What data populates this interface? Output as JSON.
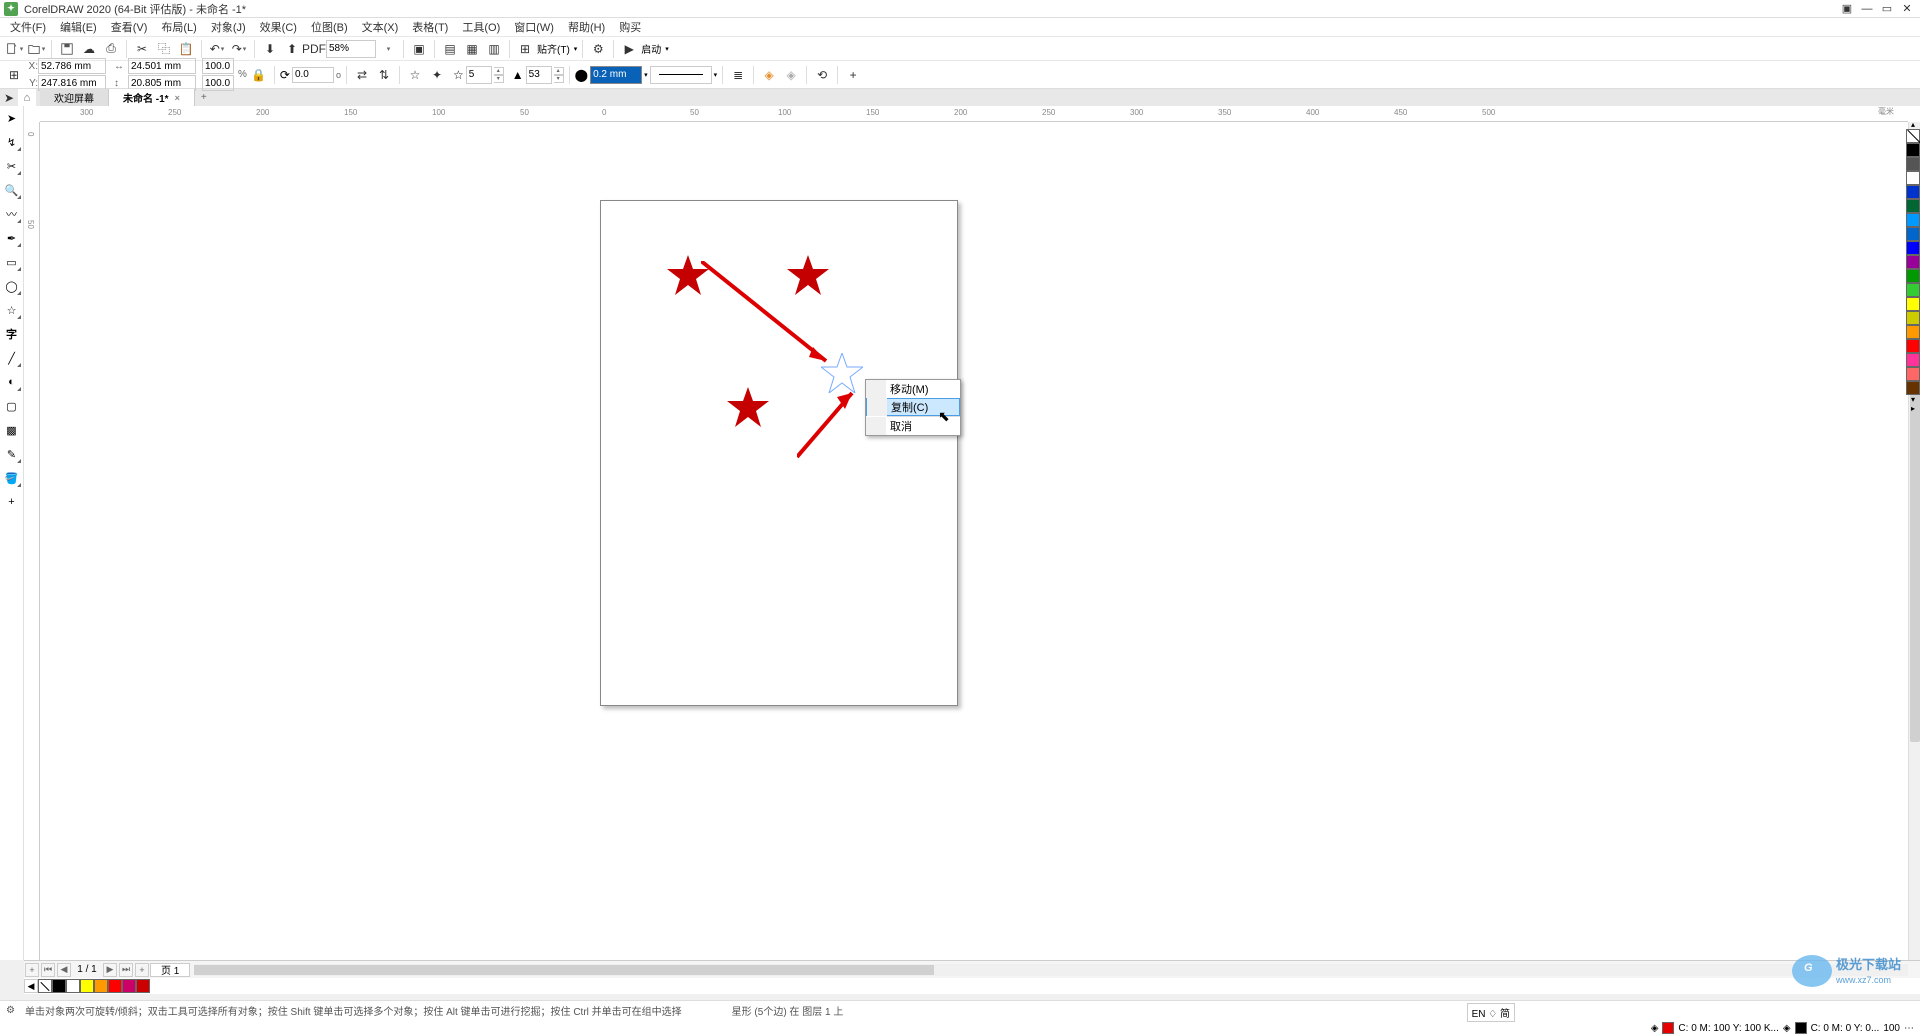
{
  "title": "CorelDRAW 2020 (64-Bit 评估版) - 未命名 -1*",
  "menus": [
    "文件(F)",
    "编辑(E)",
    "查看(V)",
    "布局(L)",
    "对象(J)",
    "效果(C)",
    "位图(B)",
    "文本(X)",
    "表格(T)",
    "工具(O)",
    "窗口(W)",
    "帮助(H)",
    "购买"
  ],
  "zoom": "58%",
  "snap_label": "贴齐(T)",
  "launch_label": "启动",
  "xy": {
    "x_label": "X:",
    "y_label": "Y:",
    "x": "52.786 mm",
    "y": "247.816 mm"
  },
  "dims": {
    "w": "24.501 mm",
    "h": "20.805 mm"
  },
  "pct": {
    "w": "100.0",
    "h": "100.0",
    "unit": "%"
  },
  "rotate": "0.0",
  "deg": "o",
  "star_points": "5",
  "star_sharp": "53",
  "outline_width": "0.2 mm",
  "tabs": {
    "welcome": "欢迎屏幕",
    "doc": "未命名 -1*"
  },
  "ruler_h": [
    "300",
    "250",
    "200",
    "150",
    "100",
    "50",
    "0",
    "50",
    "100",
    "150",
    "200",
    "250",
    "300"
  ],
  "ruler_h_extra": [
    "350",
    "400",
    "450",
    "500"
  ],
  "unit": "毫米",
  "ruler_v": [
    "0",
    "50"
  ],
  "context": {
    "move": "移动(M)",
    "copy": "复制(C)",
    "cancel": "取消"
  },
  "page_nav": {
    "label": "页 1"
  },
  "hint_lines": [
    "单击对象两次可旋转/倾斜；双击工具可选择所有对象；按住 Shift 键单击可选择多个对象；按住 Alt 键单击可进行挖掘；按住 Ctrl 并单击可在组中选择",
    "星形 (5个边) 在 图层 1 上"
  ],
  "lang": "EN ♢ 简",
  "status_fill": {
    "label": "C:  0  M:  100 Y:  100 K...",
    "outline": "C:  0  M:  0 Y: 0...",
    "outline_w": "100"
  },
  "bottom_swatches": [
    "#ffffff",
    "#ffff00",
    "#ff9900",
    "#ff0000",
    "#cc0066",
    "#cc0000"
  ],
  "palette": [
    "#000000",
    "#555555",
    "#ffffff",
    "#0033cc",
    "#006633",
    "#0099ff",
    "#0066cc",
    "#0000ff",
    "#990099",
    "#009900",
    "#33cc33",
    "#ffff00",
    "#cccc00",
    "#ff9900",
    "#ff0000",
    "#ff3399",
    "#ff6666",
    "#663300"
  ],
  "watermark": "极光下载站  www.xz7.com"
}
